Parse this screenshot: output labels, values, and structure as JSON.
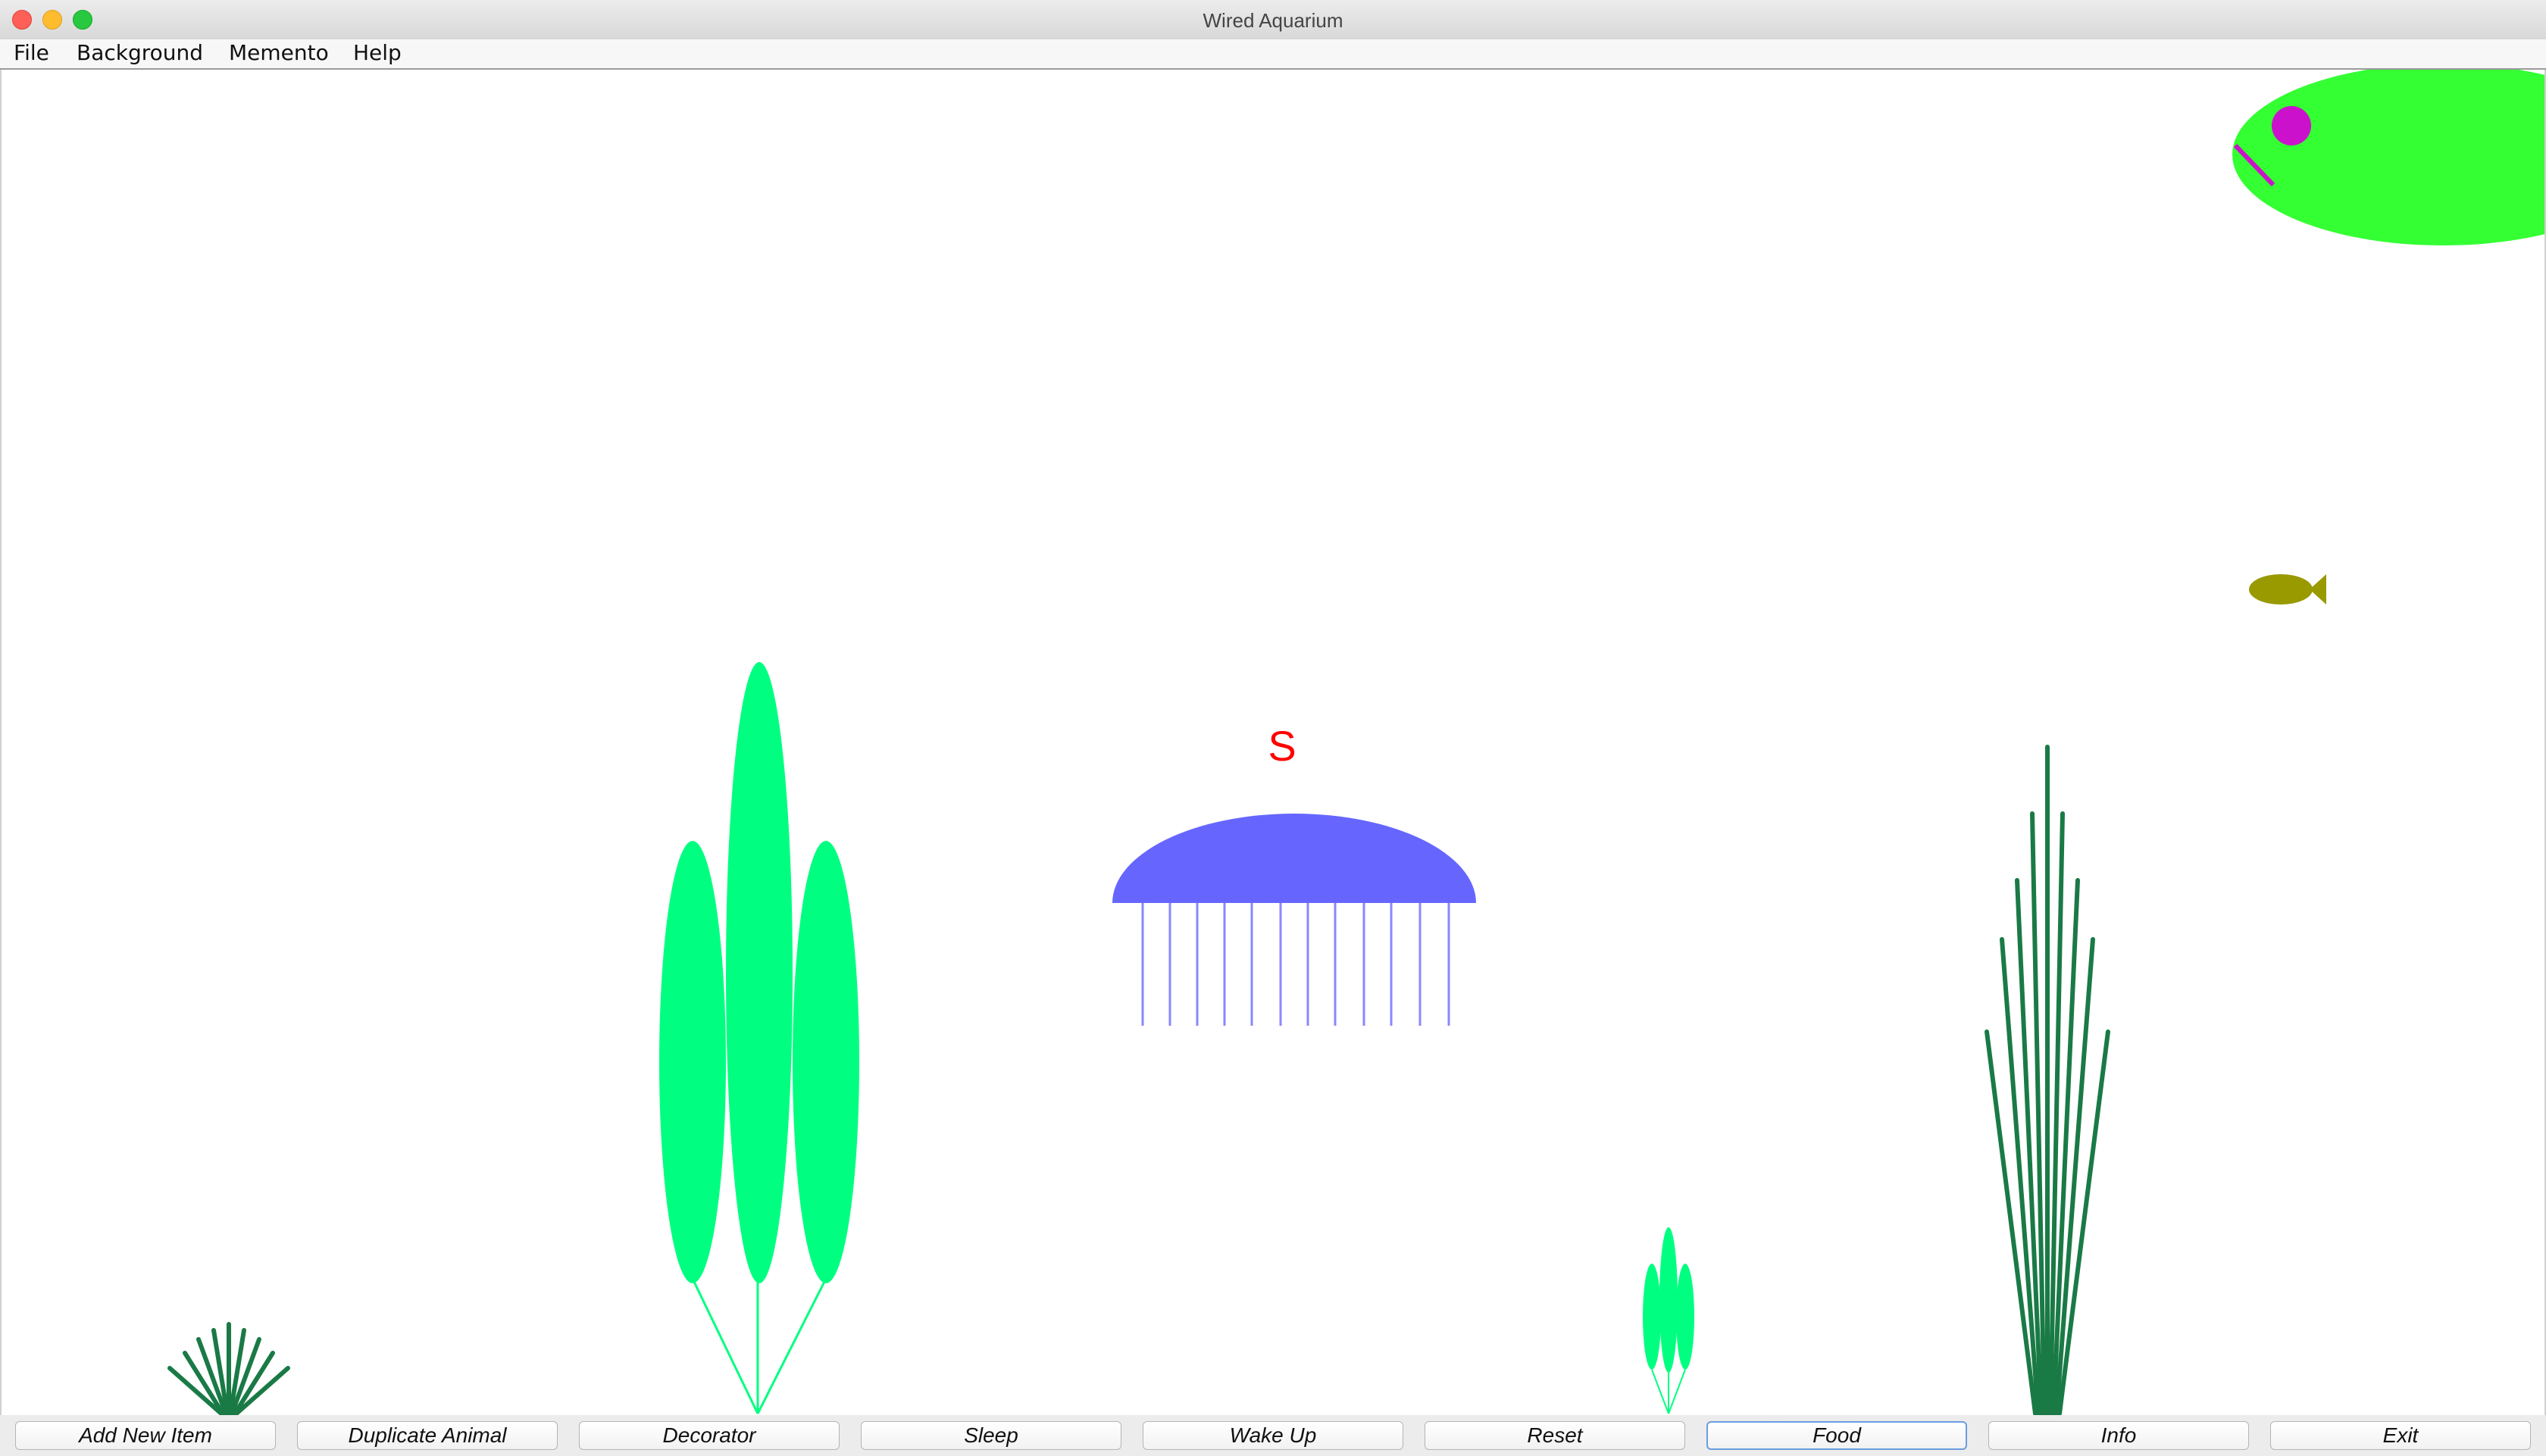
{
  "window": {
    "title": "Wired Aquarium"
  },
  "menubar": {
    "items": [
      {
        "label": "File"
      },
      {
        "label": "Background"
      },
      {
        "label": "Memento"
      },
      {
        "label": "Help"
      }
    ]
  },
  "aquarium": {
    "jellyfish_marker": "S",
    "colors": {
      "big_fish_body": "#33ff33",
      "big_fish_eye": "#cc11cc",
      "small_fish": "#999900",
      "jellyfish": "#6666ff",
      "tall_plant": "#00ff80",
      "seaweed": "#1a7a46",
      "marker": "#ff0000"
    }
  },
  "buttons": [
    {
      "label": "Add New Item"
    },
    {
      "label": "Duplicate Animal"
    },
    {
      "label": "Decorator"
    },
    {
      "label": "Sleep"
    },
    {
      "label": "Wake Up"
    },
    {
      "label": "Reset"
    },
    {
      "label": "Food"
    },
    {
      "label": "Info"
    },
    {
      "label": "Exit"
    }
  ]
}
